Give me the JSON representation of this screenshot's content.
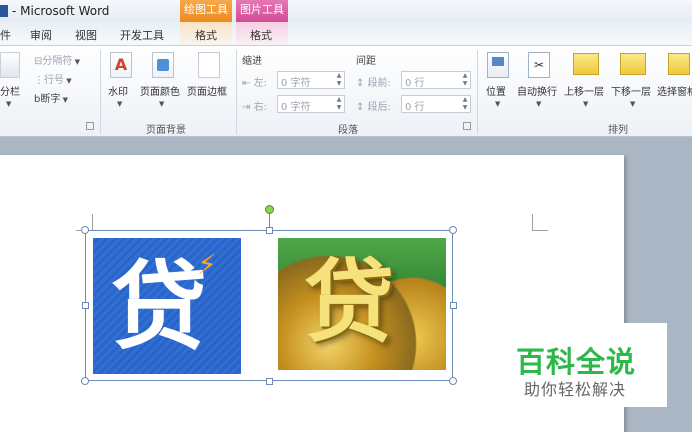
{
  "window": {
    "title": "- Microsoft Word"
  },
  "context_tabs": {
    "drawing_tools": {
      "label": "绘图工具",
      "tab": "格式",
      "color": "#f29a2e"
    },
    "picture_tools": {
      "label": "图片工具",
      "tab": "格式",
      "color": "#dd5ea4"
    }
  },
  "tabs": [
    {
      "label": "件"
    },
    {
      "label": "审阅"
    },
    {
      "label": "视图"
    },
    {
      "label": "开发工具"
    }
  ],
  "ribbon": {
    "page_setup": {
      "columns": "分栏",
      "breaks": "分隔符",
      "line_numbers": "行号",
      "hyphenation": "断字"
    },
    "page_background": {
      "group_label": "页面背景",
      "watermark": "水印",
      "page_color": "页面颜色",
      "page_borders": "页面边框"
    },
    "paragraph": {
      "group_label": "段落",
      "indent": {
        "label": "缩进",
        "left_label": "左:",
        "left_value": "0 字符",
        "right_label": "右:",
        "right_value": "0 字符"
      },
      "spacing": {
        "label": "间距",
        "before_label": "段前:",
        "before_value": "0 行",
        "after_label": "段后:",
        "after_value": "0 行"
      }
    },
    "arrange": {
      "group_label": "排列",
      "position": "位置",
      "wrap_text": "自动换行",
      "bring_forward": "上移一层",
      "send_backward": "下移一层",
      "selection_pane": "选择窗格"
    }
  },
  "document": {
    "image1": {
      "text": "贷",
      "bg_color": "#2f6fd6"
    },
    "image2": {
      "text": "贷"
    }
  },
  "watermark": {
    "title": "百科全说",
    "subtitle": "助你轻松解决",
    "color": "#2db84a"
  }
}
